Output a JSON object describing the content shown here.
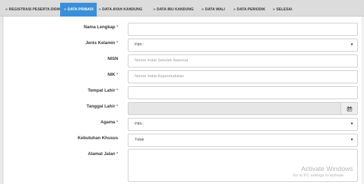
{
  "tabs": [
    {
      "label": "REGISTRASI PESERTA DIDIK",
      "active": false
    },
    {
      "label": "DATA PRIBADI",
      "active": true
    },
    {
      "label": "DATA AYAH KANDUNG",
      "active": false
    },
    {
      "label": "DATA IBU KANDUNG",
      "active": false
    },
    {
      "label": "DATA WALI",
      "active": false
    },
    {
      "label": "DATA PERIODIK",
      "active": false
    },
    {
      "label": "SELESAI",
      "active": false
    }
  ],
  "tab_arrow": "»",
  "required_mark": "*",
  "form": {
    "nama_lengkap": {
      "label": "Nama Lengkap",
      "value": ""
    },
    "jenis_kelamin": {
      "label": "Jenis Kelamin",
      "value": "Pilih :"
    },
    "nisn": {
      "label": "NISN",
      "placeholder": "Nomor Induk Sekolah Nasional"
    },
    "nik": {
      "label": "NIK",
      "placeholder": "Nomor Induk Kependudukan"
    },
    "tempat_lahir": {
      "label": "Tempat Lahir",
      "value": ""
    },
    "tanggal_lahir": {
      "label": "Tanggal Lahir",
      "value": ""
    },
    "agama": {
      "label": "Agama",
      "value": "Pilih :"
    },
    "kebutuhan_khusus": {
      "label": "Kebutuhan Khusus",
      "value": "Tidak"
    },
    "alamat_jalan": {
      "label": "Alamat Jalan",
      "value": ""
    }
  },
  "watermark": {
    "title": "Activate Windows",
    "subtitle": "Go to PC settings to activate"
  },
  "colors": {
    "accent": "#3b8fd8",
    "required": "#d9534f"
  },
  "icons": {
    "calendar": "calendar-icon",
    "caret": "caret-down-icon"
  }
}
